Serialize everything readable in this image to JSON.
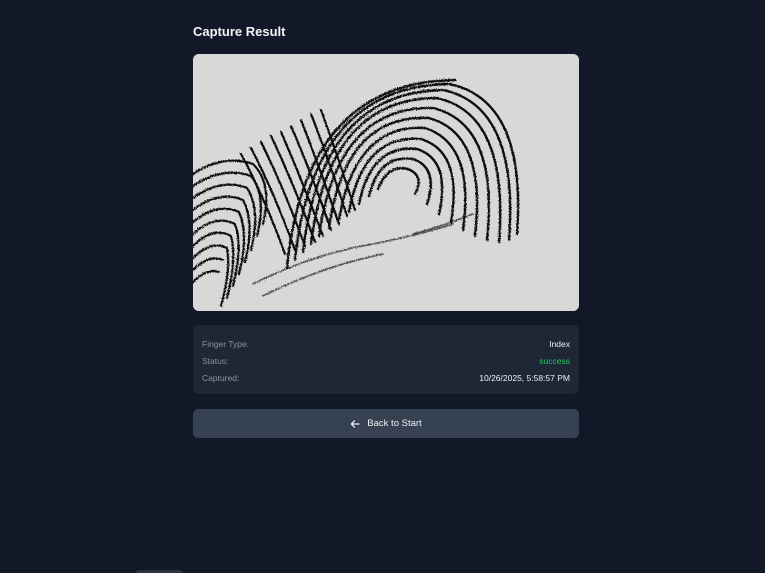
{
  "page": {
    "title": "Capture Result"
  },
  "image": {
    "alt": "Captured fingerprint"
  },
  "details": {
    "rows": [
      {
        "label": "Finger Type:",
        "value": "Index"
      },
      {
        "label": "Status:",
        "value": "success"
      },
      {
        "label": "Captured:",
        "value": "10/26/2025, 5:58:57 PM"
      }
    ]
  },
  "actions": {
    "back_label": "Back to Start",
    "back_icon": "arrow-left-icon"
  },
  "colors": {
    "background": "#121827",
    "panel": "#1f2737",
    "button": "#364152",
    "success": "#22c55e"
  }
}
